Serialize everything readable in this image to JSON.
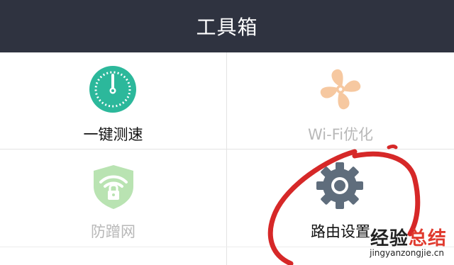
{
  "header": {
    "title": "工具箱"
  },
  "tools": [
    {
      "label": "一键测速",
      "icon": "speedometer-icon",
      "color": "#2cb89b",
      "enabled": true
    },
    {
      "label": "Wi-Fi优化",
      "icon": "fan-icon",
      "color": "#f6c8a0",
      "enabled": false
    },
    {
      "label": "防蹭网",
      "icon": "wifi-shield-icon",
      "color": "#b9e3b2",
      "enabled": false
    },
    {
      "label": "路由设置",
      "icon": "gear-icon",
      "color": "#5f6d7c",
      "enabled": true
    }
  ],
  "annotation": {
    "color": "#d62828",
    "shape": "hand-drawn circle around 路由设置"
  },
  "watermark": {
    "main_prefix": "经验",
    "main_accent": "总结",
    "url": "jingyanzongjie.cn"
  }
}
